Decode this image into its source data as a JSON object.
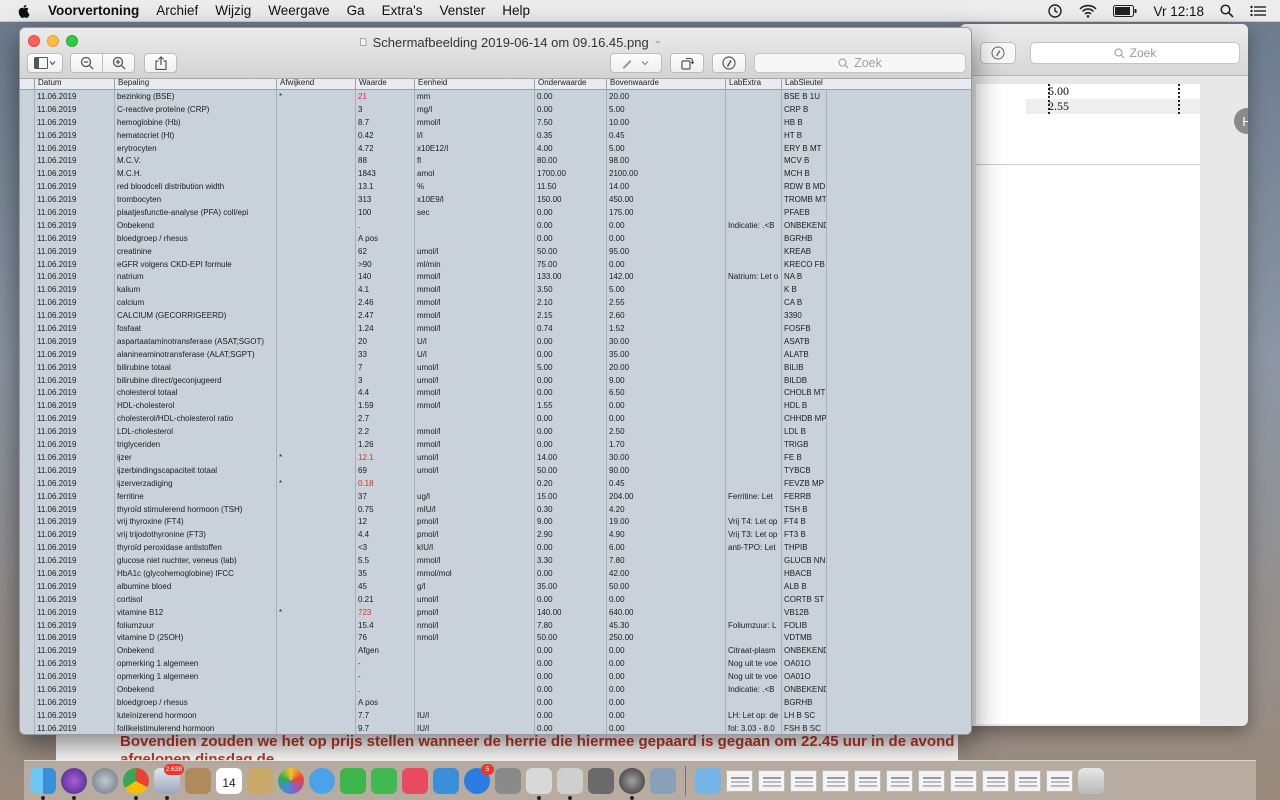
{
  "menubar": {
    "app_name": "Voorvertoning",
    "items": [
      "Archief",
      "Wijzig",
      "Weergave",
      "Ga",
      "Extra's",
      "Venster",
      "Help"
    ],
    "clock": "Vr 12:18"
  },
  "window": {
    "title": "Schermafbeelding 2019-06-14 om 09.16.45.png",
    "search_placeholder": "Zoek"
  },
  "background_window": {
    "search_placeholder": "Zoek",
    "page_values": [
      "5.00",
      "2.55"
    ],
    "avatar_letter": "H",
    "bottom_text": "Bovendien zouden we het op prijs stellen wanneer de herrie die hiermee gepaard is gegaan om 22.45 uur in de avond afgelopen dinsdag de"
  },
  "table": {
    "headers": [
      "Datum",
      "Bepaling",
      "Afwijkend",
      "Waarde",
      "Eenheid",
      "Onderwaarde",
      "Bovenwaarde",
      "LabExtra",
      "LabSleutel"
    ],
    "rows": [
      [
        "11.06.2019",
        "bezinking (BSE)",
        "*",
        "21",
        "mm",
        "0.00",
        "20.00",
        "",
        "BSE B 1U"
      ],
      [
        "11.06.2019",
        "C-reactive proteïne (CRP)",
        "",
        "3",
        "mg/l",
        "0.00",
        "5.00",
        "",
        "CRP B"
      ],
      [
        "11.06.2019",
        "hemoglobine (Hb)",
        "",
        "8.7",
        "mmol/l",
        "7.50",
        "10.00",
        "",
        "HB  B"
      ],
      [
        "11.06.2019",
        "hematocriet (Ht)",
        "",
        "0.42",
        "l/l",
        "0.35",
        "0.45",
        "",
        "HT  B"
      ],
      [
        "11.06.2019",
        "erytrocyten",
        "",
        "4.72",
        "x10E12/l",
        "4.00",
        "5.00",
        "",
        "ERY B MT"
      ],
      [
        "11.06.2019",
        "M.C.V.",
        "",
        "88",
        "fl",
        "80.00",
        "98.00",
        "",
        "MCV B"
      ],
      [
        "11.06.2019",
        "M.C.H.",
        "",
        "1843",
        "amol",
        "1700.00",
        "2100.00",
        "",
        "MCH B"
      ],
      [
        "11.06.2019",
        "red bloodcell distribution width",
        "",
        "13.1",
        "%",
        "11.50",
        "14.00",
        "",
        "RDW B MD"
      ],
      [
        "11.06.2019",
        "trombocyten",
        "",
        "313",
        "x10E9/l",
        "150.00",
        "450.00",
        "",
        "TROMB MT"
      ],
      [
        "11.06.2019",
        "plaatjesfunctie-analyse (PFA) coll/epi",
        "",
        "100",
        "sec",
        "0.00",
        "175.00",
        "",
        "PFAEB"
      ],
      [
        "11.06.2019",
        "Onbekend",
        "",
        ".",
        "",
        "0.00",
        "0.00",
        "Indicatie: .<B",
        "ONBEKEND"
      ],
      [
        "11.06.2019",
        "bloedgroep / rhesus",
        "",
        "A pos",
        "",
        "0.00",
        "0.00",
        "",
        "BGRHB"
      ],
      [
        "11.06.2019",
        "creatinine",
        "",
        "62",
        "umol/l",
        "50.00",
        "95.00",
        "",
        "KREAB"
      ],
      [
        "11.06.2019",
        "eGFR volgens CKD-EPI formule",
        "",
        ">90",
        "ml/min",
        "75.00",
        "0.00",
        "",
        "KRECO FB"
      ],
      [
        "11.06.2019",
        "natrium",
        "",
        "140",
        "mmol/l",
        "133.00",
        "142.00",
        "Natrium: Let o",
        "NA  B"
      ],
      [
        "11.06.2019",
        "kalium",
        "",
        "4.1",
        "mmol/l",
        "3.50",
        "5.00",
        "",
        "K   B"
      ],
      [
        "11.06.2019",
        "calcium",
        "",
        "2.46",
        "mmol/l",
        "2.10",
        "2.55",
        "",
        "CA  B"
      ],
      [
        "11.06.2019",
        "CALCIUM (GECORRIGEERD)",
        "",
        "2.47",
        "mmol/l",
        "2.15",
        "2.60",
        "",
        "3390"
      ],
      [
        "11.06.2019",
        "fosfaat",
        "",
        "1.24",
        "mmol/l",
        "0.74",
        "1.52",
        "",
        "FOSFB"
      ],
      [
        "11.06.2019",
        "aspartaataminotransferase (ASAT;SGOT)",
        "",
        "20",
        "U/l",
        "0.00",
        "30.00",
        "",
        "ASATB"
      ],
      [
        "11.06.2019",
        "alanineaminotransferase (ALAT;SGPT)",
        "",
        "33",
        "U/l",
        "0.00",
        "35.00",
        "",
        "ALATB"
      ],
      [
        "11.06.2019",
        "bilirubine totaal",
        "",
        "7",
        "umol/l",
        "5.00",
        "20.00",
        "",
        "BILIB"
      ],
      [
        "11.06.2019",
        "bilirubine direct/geconjugeerd",
        "",
        "3",
        "umol/l",
        "0.00",
        "9.00",
        "",
        "BILDB"
      ],
      [
        "11.06.2019",
        "cholesterol totaal",
        "",
        "4.4",
        "mmol/l",
        "0.00",
        "6.50",
        "",
        "CHOLB MT"
      ],
      [
        "11.06.2019",
        "HDL-cholesterol",
        "",
        "1.59",
        "mmol/l",
        "1.55",
        "0.00",
        "",
        "HDL B"
      ],
      [
        "11.06.2019",
        "cholesterol/HDL-cholesterol ratio",
        "",
        "2.7",
        "",
        "0.00",
        "0.00",
        "",
        "CHHDB MP"
      ],
      [
        "11.06.2019",
        "LDL-cholesterol",
        "",
        "2.2",
        "mmol/l",
        "0.00",
        "2.50",
        "",
        "LDL B"
      ],
      [
        "11.06.2019",
        "triglyceriden",
        "",
        "1.26",
        "mmol/l",
        "0.00",
        "1.70",
        "",
        "TRIGB"
      ],
      [
        "11.06.2019",
        "ijzer",
        "*",
        "12.1",
        "umol/l",
        "14.00",
        "30.00",
        "",
        "FE  B"
      ],
      [
        "11.06.2019",
        "ijzerbindingscapaciteit totaal",
        "",
        "69",
        "umol/l",
        "50.00",
        "90.00",
        "",
        "TYBCB"
      ],
      [
        "11.06.2019",
        "ijzerverzadiging",
        "*",
        "0.18",
        "",
        "0.20",
        "0.45",
        "",
        "FEVZB MP"
      ],
      [
        "11.06.2019",
        "ferritine",
        "",
        "37",
        "ug/l",
        "15.00",
        "204.00",
        "Ferritine: Let",
        "FERRB"
      ],
      [
        "11.06.2019",
        "thyroïd stimulerend hormoon (TSH)",
        "",
        "0.75",
        "mIU/l",
        "0.30",
        "4.20",
        "",
        "TSH B"
      ],
      [
        "11.06.2019",
        "vrij thyroxine (FT4)",
        "",
        "12",
        "pmol/l",
        "9.00",
        "19.00",
        "Vrij T4: Let op",
        "FT4 B"
      ],
      [
        "11.06.2019",
        "vrij trijodothyronine (FT3)",
        "",
        "4.4",
        "pmol/l",
        "2.90",
        "4.90",
        "Vrij T3: Let op",
        "FT3 B"
      ],
      [
        "11.06.2019",
        "thyroïd peroxidase antistoffen",
        "",
        "<3",
        "kIU/l",
        "0.00",
        "6.00",
        "anti-TPO: Let",
        "THPIB"
      ],
      [
        "11.06.2019",
        "glucose niet nuchter, veneus (lab)",
        "",
        "5.5",
        "mmol/l",
        "3.30",
        "7.80",
        "",
        "GLUCB NN"
      ],
      [
        "11.06.2019",
        "HbA1c (glycohemoglobine) IFCC",
        "",
        "35",
        "mmol/mol",
        "0.00",
        "42.00",
        "",
        "HBACB"
      ],
      [
        "11.06.2019",
        "albumine bloed",
        "",
        "45",
        "g/l",
        "35.00",
        "50.00",
        "",
        "ALB B"
      ],
      [
        "11.06.2019",
        "cortisol",
        "",
        "0.21",
        "umol/l",
        "0.00",
        "0.00",
        "",
        "CORTB ST"
      ],
      [
        "11.06.2019",
        "vitamine B12",
        "*",
        "723",
        "pmol/l",
        "140.00",
        "640.00",
        "",
        "VB12B"
      ],
      [
        "11.06.2019",
        "foliumzuur",
        "",
        "15.4",
        "nmol/l",
        "7.80",
        "45.30",
        "Foliumzuur: L",
        "FOLIB"
      ],
      [
        "11.06.2019",
        "vitamine D (25OH)",
        "",
        "76",
        "nmol/l",
        "50.00",
        "250.00",
        "",
        "VDTMB"
      ],
      [
        "11.06.2019",
        "Onbekend",
        "",
        "Afgen",
        "",
        "0.00",
        "0.00",
        " Citraat-plasm",
        "ONBEKEND"
      ],
      [
        "11.06.2019",
        "opmerking 1 algemeen",
        "",
        "-",
        "",
        "0.00",
        "0.00",
        "Nog uit te voe",
        "OA01O"
      ],
      [
        "11.06.2019",
        "opmerking 1 algemeen",
        "",
        "-",
        "",
        "0.00",
        "0.00",
        "Nog uit te voe",
        "OA01O"
      ],
      [
        "11.06.2019",
        "Onbekend",
        "",
        ".",
        "",
        "0.00",
        "0.00",
        "Indicatie: .<B",
        "ONBEKEND"
      ],
      [
        "11.06.2019",
        "bloedgroep / rhesus",
        "",
        "A pos",
        "",
        "0.00",
        "0.00",
        "",
        "BGRHB"
      ],
      [
        "11.06.2019",
        "luteïnizerend hormoon",
        "",
        "7.7",
        "IU/l",
        "0.00",
        "0.00",
        "LH: Let op: de",
        "LH  B SC"
      ],
      [
        "11.06.2019",
        "follikelstimulerend hormoon",
        "",
        "9.7",
        "IU/l",
        "0.00",
        "0.00",
        "fol: 3.03 - 8.0",
        "FSH B SC"
      ]
    ]
  },
  "dock": {
    "calendar_day": "14",
    "mail_badge": "2.638",
    "appstore_badge": "5"
  },
  "colors": {
    "table_bg": "#c9d1da",
    "abnormal_value": "#e0312b",
    "traffic_close": "#fc605c",
    "traffic_min": "#fdbc40",
    "traffic_max": "#34c84a"
  }
}
